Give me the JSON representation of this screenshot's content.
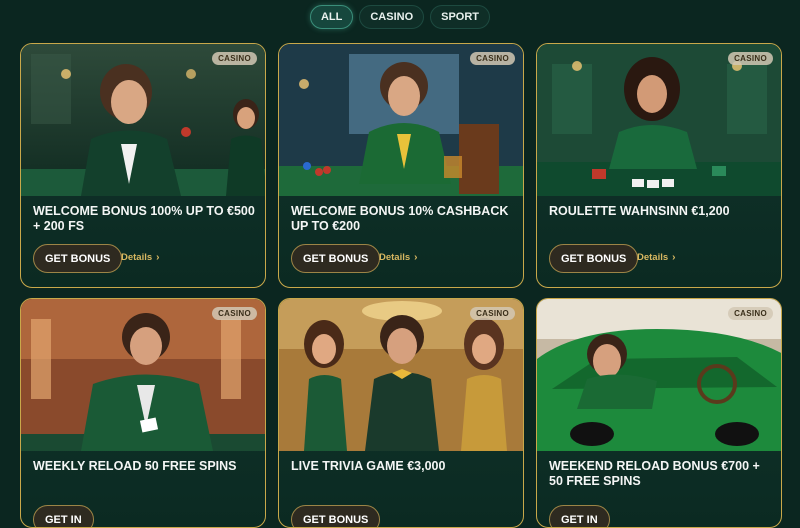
{
  "filters": [
    "ALL",
    "CASINO",
    "SPORT"
  ],
  "badge": "CASINO",
  "details_label": "Details",
  "cards": [
    {
      "title": "WELCOME BONUS 100% UP TO €500 + 200 FS",
      "button": "GET BONUS"
    },
    {
      "title": "WELCOME BONUS 10% CASHBACK UP TO €200",
      "button": "GET BONUS"
    },
    {
      "title": "ROULETTE WAHNSINN €1,200",
      "button": "GET BONUS"
    },
    {
      "title": "WEEKLY RELOAD 50 FREE SPINS",
      "button": "GET IN"
    },
    {
      "title": "LIVE TRIVIA GAME €3,000",
      "button": "GET BONUS"
    },
    {
      "title": "WEEKEND RELOAD BONUS €700 + 50 FREE SPINS",
      "button": "GET IN"
    }
  ],
  "colors": {
    "background": "#0b2620",
    "accent_gold": "#c9a84a",
    "details": "#d8b861"
  }
}
